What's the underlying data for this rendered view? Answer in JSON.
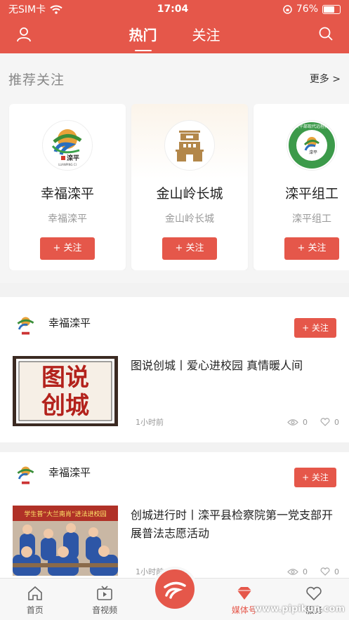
{
  "status_bar": {
    "carrier": "无SIM卡",
    "time": "17:04",
    "battery": "76%",
    "battery_level": 0.76
  },
  "header": {
    "tabs": [
      {
        "label": "热门",
        "active": true
      },
      {
        "label": "关注",
        "active": false
      }
    ]
  },
  "recommend": {
    "title": "推荐关注",
    "more": "更多 >",
    "cards": [
      {
        "name": "幸福滦平",
        "sub": "幸福滦平",
        "follow": "+ 关注",
        "logo_text": "滦平",
        "logo_small": "LUANPING CI"
      },
      {
        "name": "金山岭长城",
        "sub": "金山岭长城",
        "follow": "+ 关注"
      },
      {
        "name": "滦平组工",
        "sub": "滦平组工",
        "follow": "+ 关注",
        "logo_text": "滦平",
        "logo_ring_text": "党员干部现代远程教育"
      }
    ]
  },
  "feed": [
    {
      "author": "幸福滦平",
      "follow": "+ 关注",
      "title": "图说创城丨爱心进校园 真情暖人间",
      "thumb_line1": "图说",
      "thumb_line2": "创城",
      "time": "1小时前",
      "views": "0",
      "likes": "0"
    },
    {
      "author": "幸福滦平",
      "follow": "+ 关注",
      "title": "创城进行时丨滦平县检察院第一党支部开展普法志愿活动",
      "thumb_banner": "学生普“大兰南肖”进法进校园",
      "time": "1小时前",
      "views": "0",
      "likes": "0"
    }
  ],
  "tabbar": {
    "items": [
      "首页",
      "音视频",
      "",
      "媒体号",
      "服务"
    ],
    "active_index": 3
  },
  "watermark": "www.pipikun.com",
  "colors": {
    "accent": "#e5574a",
    "bg": "#f2f2f2"
  }
}
